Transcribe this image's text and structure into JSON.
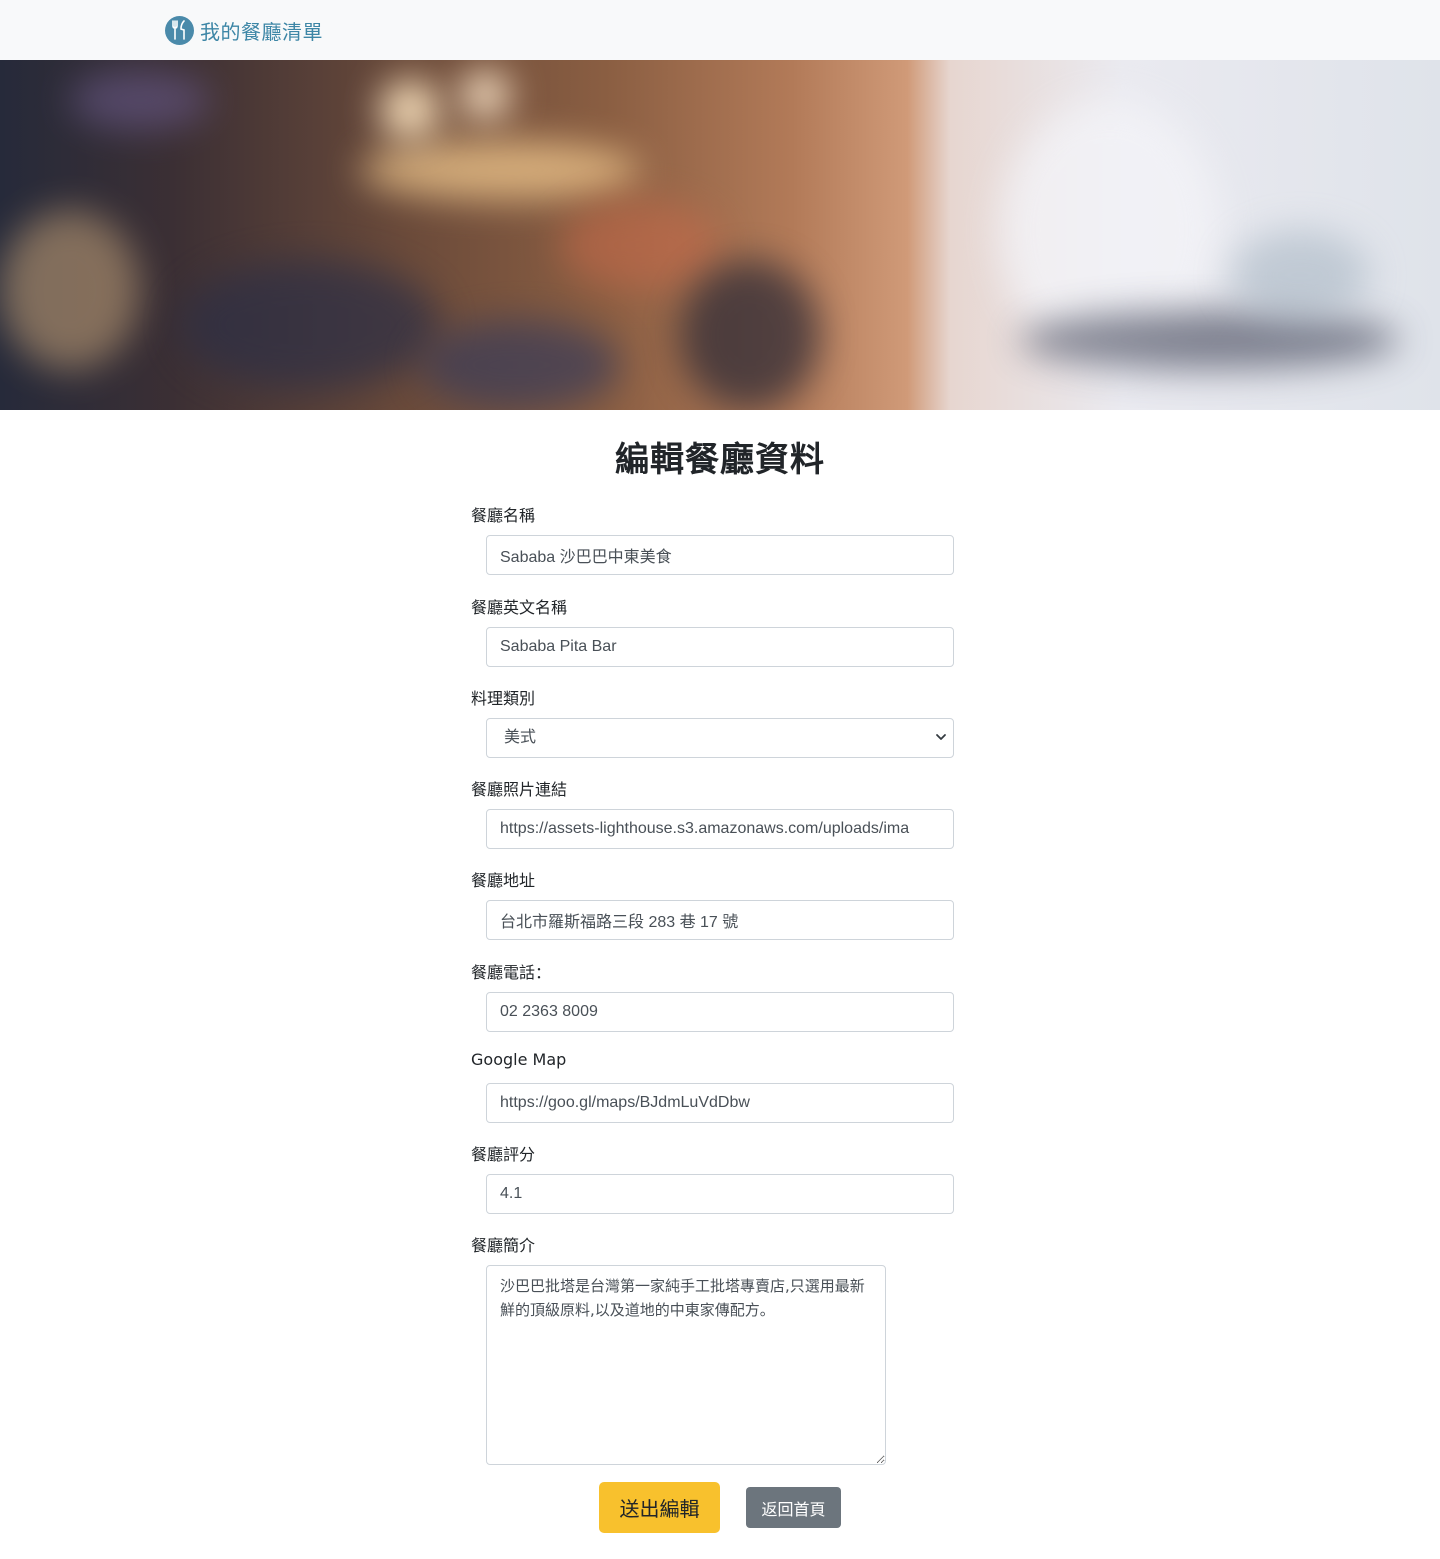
{
  "navbar": {
    "brand_icon": "utensils-icon",
    "brand_text": "我的餐廳清單",
    "brand_color": "#3d86a6"
  },
  "banner": {
    "description_icon": "restaurant-interior-photo"
  },
  "page": {
    "title": "編輯餐廳資料"
  },
  "form": {
    "name": {
      "label": "餐廳名稱",
      "value": "Sababa 沙巴巴中東美食"
    },
    "name_en": {
      "label": "餐廳英文名稱",
      "value": "Sababa Pita Bar"
    },
    "category": {
      "label": "料理類別",
      "value": "美式"
    },
    "image": {
      "label": "餐廳照片連結",
      "value": "https://assets-lighthouse.s3.amazonaws.com/uploads/ima"
    },
    "location": {
      "label": "餐廳地址",
      "value": "台北市羅斯福路三段 283 巷 17 號"
    },
    "phone": {
      "label": "餐廳電話：",
      "value": "02 2363 8009"
    },
    "google_map": {
      "label": "Google Map",
      "value": "https://goo.gl/maps/BJdmLuVdDbw"
    },
    "rating": {
      "label": "餐廳評分",
      "value": "4.1"
    },
    "description": {
      "label": "餐廳簡介",
      "value": "沙巴巴批塔是台灣第一家純手工批塔專賣店,只選用最新鮮的頂級原料,以及道地的中東家傳配方。"
    }
  },
  "buttons": {
    "submit_label": "送出編輯",
    "submit_color": "#f8c12d",
    "back_label": "返回首頁",
    "back_color": "#6c757d"
  }
}
